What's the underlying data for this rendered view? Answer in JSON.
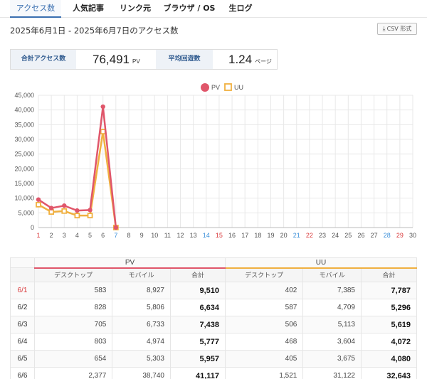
{
  "tabs": [
    {
      "label": "アクセス数",
      "active": true
    },
    {
      "label": "人気記事",
      "active": false
    },
    {
      "label": "リンク元",
      "active": false
    },
    {
      "label": "ブラウザ / OS",
      "active": false
    },
    {
      "label": "生ログ",
      "active": false
    }
  ],
  "header": {
    "date_range": "2025年6月1日 - 2025年6月7日のアクセス数",
    "csv_label": "CSV 形式"
  },
  "summary": {
    "total_label": "合計アクセス数",
    "total_value": "76,491",
    "total_unit": "PV",
    "avg_label": "平均回遊数",
    "avg_value": "1.24",
    "avg_unit": "ページ"
  },
  "colors": {
    "pv": "#e0566a",
    "uu": "#f0b040",
    "saturday": "#3b8fd9",
    "sunday": "#d9383a",
    "grid": "#e8e8e8"
  },
  "chart_data": {
    "type": "line",
    "legend": [
      "PV",
      "UU"
    ],
    "x": [
      "1",
      "2",
      "3",
      "4",
      "5",
      "6",
      "7",
      "8",
      "9",
      "10",
      "11",
      "12",
      "13",
      "14",
      "15",
      "16",
      "17",
      "18",
      "19",
      "20",
      "21",
      "22",
      "23",
      "24",
      "25",
      "26",
      "27",
      "28",
      "29",
      "30"
    ],
    "saturday_ticks": [
      "7",
      "14",
      "21",
      "28"
    ],
    "sunday_ticks": [
      "1",
      "15",
      "22",
      "29"
    ],
    "yticks": [
      "0",
      "5,000",
      "10,000",
      "15,000",
      "20,000",
      "25,000",
      "30,000",
      "35,000",
      "40,000",
      "45,000"
    ],
    "ylim": [
      0,
      45000
    ],
    "series": [
      {
        "name": "PV",
        "values": [
          9510,
          6634,
          7438,
          5777,
          5957,
          41117,
          0
        ]
      },
      {
        "name": "UU",
        "values": [
          7787,
          5296,
          5619,
          4072,
          4080,
          32643,
          0
        ]
      }
    ]
  },
  "table": {
    "groups": [
      "PV",
      "UU"
    ],
    "subheaders": [
      "デスクトップ",
      "モバイル",
      "合計",
      "デスクトップ",
      "モバイル",
      "合計"
    ],
    "rows": [
      {
        "date": "6/1",
        "sunday": true,
        "cells": [
          "583",
          "8,927",
          "9,510",
          "402",
          "7,385",
          "7,787"
        ]
      },
      {
        "date": "6/2",
        "sunday": false,
        "cells": [
          "828",
          "5,806",
          "6,634",
          "587",
          "4,709",
          "5,296"
        ]
      },
      {
        "date": "6/3",
        "sunday": false,
        "cells": [
          "705",
          "6,733",
          "7,438",
          "506",
          "5,113",
          "5,619"
        ]
      },
      {
        "date": "6/4",
        "sunday": false,
        "cells": [
          "803",
          "4,974",
          "5,777",
          "468",
          "3,604",
          "4,072"
        ]
      },
      {
        "date": "6/5",
        "sunday": false,
        "cells": [
          "654",
          "5,303",
          "5,957",
          "405",
          "3,675",
          "4,080"
        ]
      },
      {
        "date": "6/6",
        "sunday": false,
        "cells": [
          "2,377",
          "38,740",
          "41,117",
          "1,521",
          "31,122",
          "32,643"
        ]
      }
    ]
  }
}
